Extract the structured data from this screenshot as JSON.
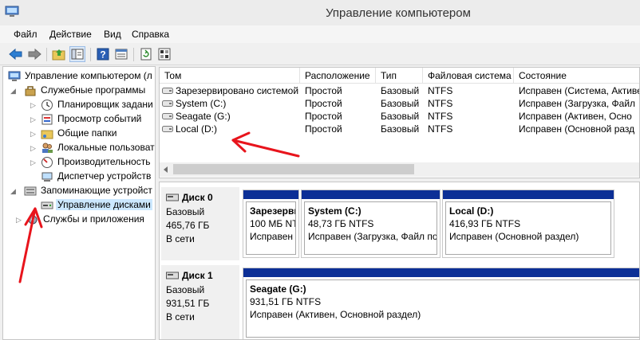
{
  "window": {
    "title": "Управление компьютером"
  },
  "menu": [
    "Файл",
    "Действие",
    "Вид",
    "Справка"
  ],
  "tree": {
    "root": "Управление компьютером (л",
    "utilities": "Служебные программы",
    "scheduler": "Планировщик задани",
    "event_viewer": "Просмотр событий",
    "shared_folders": "Общие папки",
    "local_users": "Локальные пользоват",
    "performance": "Производительность",
    "device_manager": "Диспетчер устройств",
    "storage": "Запоминающие устройст",
    "disk_management": "Управление дисками",
    "services": "Службы и приложения"
  },
  "volumes": {
    "columns": [
      "Том",
      "Расположение",
      "Тип",
      "Файловая система",
      "Состояние"
    ],
    "rows": [
      [
        "Зарезервировано системой",
        "Простой",
        "Базовый",
        "NTFS",
        "Исправен (Система, Активе"
      ],
      [
        "System (C:)",
        "Простой",
        "Базовый",
        "NTFS",
        "Исправен (Загрузка, Файл"
      ],
      [
        "Seagate (G:)",
        "Простой",
        "Базовый",
        "NTFS",
        "Исправен (Активен, Осно"
      ],
      [
        "Local (D:)",
        "Простой",
        "Базовый",
        "NTFS",
        "Исправен (Основной разд"
      ]
    ]
  },
  "disks": [
    {
      "name": "Диск 0",
      "type": "Базовый",
      "size": "465,76 ГБ",
      "status": "В сети",
      "partitions": [
        {
          "name": "Зарезерви",
          "detail": "100 МБ NTF",
          "status": "Исправен ("
        },
        {
          "name": "System  (C:)",
          "detail": "48,73 ГБ NTFS",
          "status": "Исправен (Загрузка, Файл по"
        },
        {
          "name": "Local  (D:)",
          "detail": "416,93 ГБ NTFS",
          "status": "Исправен (Основной раздел)"
        }
      ]
    },
    {
      "name": "Диск 1",
      "type": "Базовый",
      "size": "931,51 ГБ",
      "status": "В сети",
      "partitions": [
        {
          "name": "Seagate  (G:)",
          "detail": "931,51 ГБ NTFS",
          "status": "Исправен (Активен, Основной раздел)"
        }
      ]
    }
  ],
  "colors": {
    "partition_bar": "#0c2f96",
    "arrow": "#e8141c"
  }
}
